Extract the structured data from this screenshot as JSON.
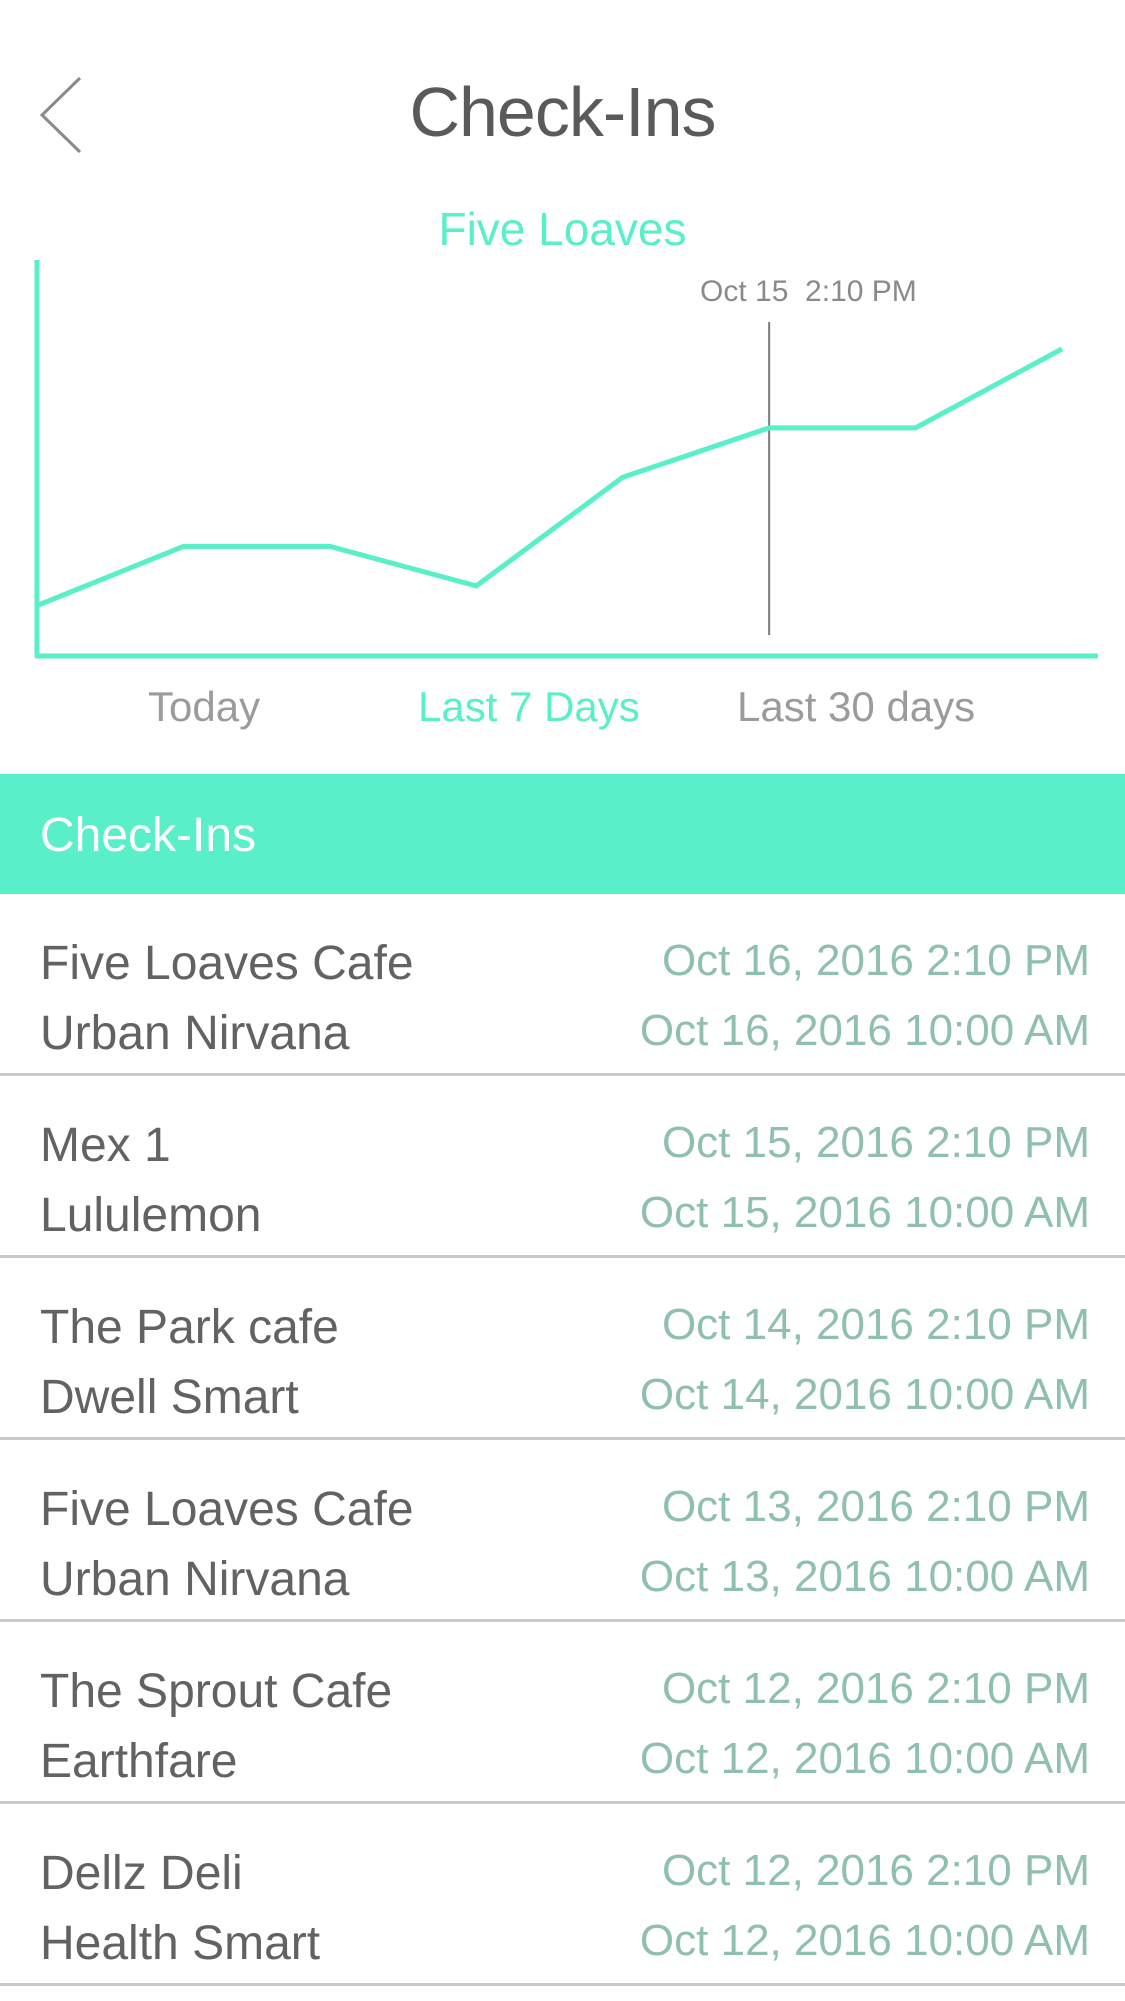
{
  "header": {
    "title": "Check-Ins",
    "back_icon": "chevron-left-icon"
  },
  "chart": {
    "title": "Five Loaves",
    "annotation": "Oct 15  2:10 PM"
  },
  "chart_data": {
    "type": "line",
    "title": "Five Loaves",
    "xlabel": "",
    "ylabel": "",
    "x": [
      0,
      1,
      2,
      3,
      4,
      5,
      6,
      7
    ],
    "values": [
      2,
      4.4,
      4.4,
      2.8,
      7.2,
      9.2,
      9.2,
      12.4
    ],
    "ylim": [
      0,
      16
    ],
    "grid": false,
    "marker_index": 5,
    "marker_label": "Oct 15  2:10 PM",
    "color": "#58efc9"
  },
  "tabs": [
    {
      "label": "Today",
      "active": false
    },
    {
      "label": "Last 7 Days",
      "active": true
    },
    {
      "label": "Last 30 days",
      "active": false
    }
  ],
  "section": {
    "title": "Check-Ins"
  },
  "checkins": [
    {
      "place1": "Five Loaves Cafe",
      "time1": "Oct 16, 2016 2:10 PM",
      "place2": "Urban Nirvana",
      "time2": "Oct 16, 2016 10:00 AM"
    },
    {
      "place1": "Mex 1",
      "time1": "Oct 15, 2016 2:10 PM",
      "place2": "Lululemon",
      "time2": "Oct 15, 2016 10:00 AM"
    },
    {
      "place1": "The Park cafe",
      "time1": "Oct 14, 2016 2:10 PM",
      "place2": "Dwell Smart",
      "time2": "Oct 14, 2016 10:00 AM"
    },
    {
      "place1": "Five Loaves Cafe",
      "time1": "Oct 13, 2016 2:10 PM",
      "place2": "Urban Nirvana",
      "time2": "Oct 13, 2016 10:00 AM"
    },
    {
      "place1": "The Sprout Cafe",
      "time1": "Oct 12, 2016 2:10 PM",
      "place2": "Earthfare",
      "time2": "Oct 12, 2016 10:00 AM"
    },
    {
      "place1": "Dellz Deli",
      "time1": "Oct 12, 2016 2:10 PM",
      "place2": "Health Smart",
      "time2": "Oct 12, 2016 10:00 AM"
    }
  ],
  "colors": {
    "accent": "#58efc9",
    "time_text": "#8fbfae",
    "primary_text": "#626262",
    "muted_text": "#9b9b9b"
  }
}
